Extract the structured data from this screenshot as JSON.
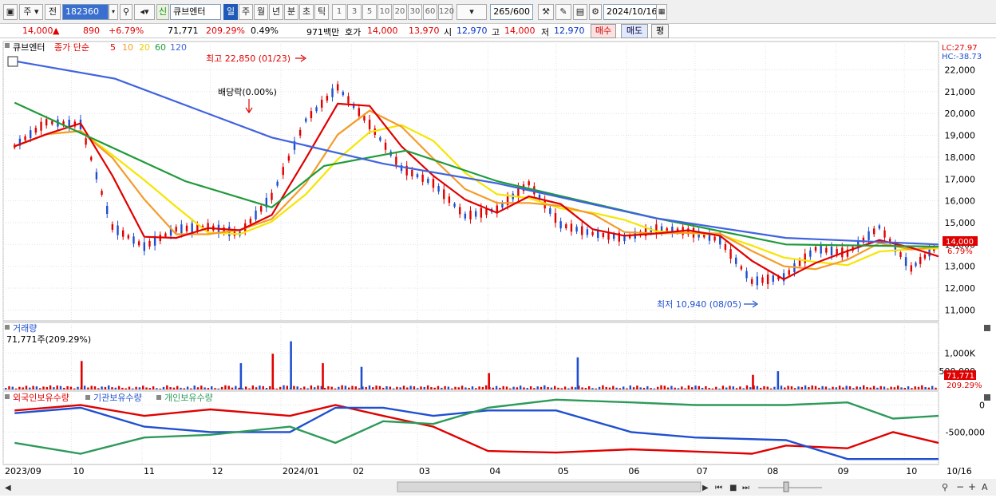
{
  "toolbar": {
    "market": "주",
    "prev_button": "전",
    "code": "182360",
    "credit_badge": "신",
    "stock_name": "큐브엔터",
    "periods": [
      "일",
      "주",
      "월",
      "년",
      "분",
      "초",
      "틱"
    ],
    "active_period": "일",
    "intervals": [
      "1",
      "3",
      "5",
      "10",
      "20",
      "30",
      "60",
      "120"
    ],
    "count": "265",
    "count_total": "/600",
    "date": "2024/10/16"
  },
  "quote": {
    "price": "14,000",
    "change_arrow": "▲",
    "change": "890",
    "change_pct": "+6.79%",
    "volume": "71,771",
    "vol_ratio": "209.29%",
    "turnover_pct": "0.49%",
    "amount": "971백만",
    "ask_label": "호가",
    "ask": "14,000",
    "bid": "13,970",
    "open_label": "시",
    "open": "12,970",
    "high_label": "고",
    "high": "14,000",
    "low_label": "저",
    "low": "12,970",
    "buy_button": "매수",
    "sell_button": "매도",
    "eval_button": "평"
  },
  "colors": {
    "up": "#e00000",
    "down": "#1f4fd0",
    "ma5": "#e00000",
    "ma10": "#f39c2a",
    "ma20": "#f5e600",
    "ma60": "#1e9a3a",
    "ma120": "#3f63e0"
  },
  "chart_data": [
    {
      "type": "line",
      "title": "큐브엔터",
      "legend": {
        "label": "종가 단순",
        "periods": [
          "5",
          "10",
          "20",
          "60",
          "120"
        ]
      },
      "x_ticks": [
        "2023/09",
        "10",
        "11",
        "12",
        "2024/01",
        "02",
        "03",
        "04",
        "05",
        "06",
        "07",
        "08",
        "09",
        "10",
        "10/16"
      ],
      "y_ticks": [
        "22,000",
        "21,000",
        "20,000",
        "19,000",
        "18,000",
        "17,000",
        "16,000",
        "15,000",
        "14,000",
        "13,000",
        "12,000",
        "11,000"
      ],
      "ylim": [
        10500,
        23300
      ],
      "lc": "LC:27.97",
      "hc": "HC:-38.73",
      "last_price_label": "14,000",
      "last_pct_label": "6.79%",
      "annotations": {
        "high": "최고 22,850 (01/23)",
        "low": "최저 10,940 (08/05)",
        "ex_dividend": "배당락(0.00%)"
      },
      "close": {
        "x": [
          "09/06",
          "09/20",
          "10/05",
          "10/19",
          "11/02",
          "11/16",
          "11/30",
          "12/14",
          "12/28",
          "01/12",
          "01/26",
          "02/09",
          "02/23",
          "03/08",
          "03/22",
          "04/05",
          "04/19",
          "05/03",
          "05/17",
          "05/31",
          "06/14",
          "06/28",
          "07/12",
          "07/26",
          "08/09",
          "08/23",
          "09/06",
          "09/20",
          "10/04",
          "10/16"
        ],
        "y": [
          18500,
          19600,
          19500,
          14800,
          13900,
          14700,
          14800,
          14500,
          16200,
          19700,
          21200,
          19500,
          17500,
          16800,
          15300,
          15600,
          16800,
          14900,
          14500,
          14300,
          14700,
          14600,
          14200,
          12300,
          12500,
          13800,
          13600,
          14800,
          12900,
          14000
        ]
      },
      "ma120": {
        "x": [
          "09/06",
          "10/20",
          "12/28",
          "02/15",
          "04/05",
          "06/14",
          "08/10",
          "10/16"
        ],
        "y": [
          22400,
          21600,
          18900,
          17700,
          16800,
          15200,
          14300,
          14000
        ]
      },
      "ma60": {
        "x": [
          "09/06",
          "11/20",
          "12/28",
          "01/20",
          "02/25",
          "04/05",
          "06/14",
          "08/10",
          "10/16"
        ],
        "y": [
          20500,
          16900,
          15700,
          17600,
          18300,
          16900,
          15200,
          14000,
          13900
        ]
      }
    },
    {
      "type": "bar",
      "title": "거래량",
      "summary": "71,771주(209.29%)",
      "y_ticks": [
        "1,000K",
        "500,000"
      ],
      "last_volume_label": "71,771",
      "last_pct_label": "209.29%",
      "spikes": {
        "x": [
          "10/05",
          "12/14",
          "12/28",
          "01/05",
          "01/19",
          "02/05",
          "04/01",
          "05/10",
          "07/26",
          "08/06"
        ],
        "y": [
          780000,
          720000,
          980000,
          1320000,
          720000,
          620000,
          450000,
          880000,
          400000,
          500000
        ]
      },
      "base_volume": 120000
    },
    {
      "type": "line",
      "legend": [
        "외국인보유수량",
        "기관보유수량",
        "개인보유수량"
      ],
      "y_ticks": [
        "0",
        "-500,000"
      ],
      "series": [
        {
          "name": "외국인보유수량",
          "color": "#e00000",
          "x": [
            "09/06",
            "10/05",
            "11/02",
            "12/01",
            "01/05",
            "01/25",
            "02/15",
            "03/08",
            "04/01",
            "05/01",
            "06/03",
            "07/01",
            "07/26",
            "08/10",
            "09/06",
            "09/26",
            "10/16"
          ],
          "y": [
            -100000,
            0,
            -200000,
            -80000,
            -200000,
            0,
            -200000,
            -400000,
            -850000,
            -880000,
            -820000,
            -860000,
            -900000,
            -750000,
            -800000,
            -500000,
            -700000
          ]
        },
        {
          "name": "기관보유수량",
          "color": "#1f4fd0",
          "x": [
            "09/06",
            "10/05",
            "11/02",
            "12/01",
            "01/05",
            "01/25",
            "02/15",
            "03/08",
            "04/01",
            "05/01",
            "06/03",
            "07/01",
            "08/10",
            "09/06",
            "10/16"
          ],
          "y": [
            -150000,
            -50000,
            -400000,
            -500000,
            -500000,
            -50000,
            -50000,
            -200000,
            -100000,
            -100000,
            -500000,
            -600000,
            -650000,
            -1000000,
            -1000000
          ]
        },
        {
          "name": "개인보유수량",
          "color": "#2d9a5a",
          "x": [
            "09/06",
            "10/05",
            "11/02",
            "12/01",
            "01/05",
            "01/25",
            "02/15",
            "03/08",
            "04/01",
            "05/01",
            "06/03",
            "07/01",
            "08/10",
            "09/06",
            "09/26",
            "10/16"
          ],
          "y": [
            -700000,
            -900000,
            -600000,
            -550000,
            -400000,
            -700000,
            -300000,
            -350000,
            -50000,
            100000,
            50000,
            0,
            0,
            50000,
            -250000,
            -200000
          ]
        }
      ]
    }
  ]
}
